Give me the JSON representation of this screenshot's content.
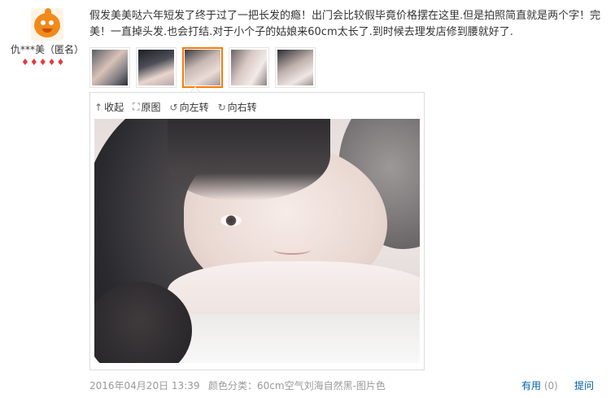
{
  "user": {
    "name": "仇***美（匿名）",
    "level_icons": [
      "gem-icon",
      "gem-icon",
      "gem-icon",
      "gem-icon",
      "gem-icon"
    ]
  },
  "review": {
    "text": "假发美美哒六年短发了终于过了一把长发的瘾！出门会比较假毕竟价格摆在这里.但是拍照简直就是两个字！完美！一直掉头发.也会打结.对于小个子的姑娘来60cm太长了.到时候去理发店修到腰就好了."
  },
  "thumbnails": {
    "count": 5,
    "active_index": 2
  },
  "viewer_toolbar": {
    "collapse": "收起",
    "original": "原图",
    "rotate_left": "向左转",
    "rotate_right": "向右转"
  },
  "footer": {
    "date": "2016年04月20日 13:39",
    "variant_label": "颜色分类：",
    "variant_value": "60cm空气刘海自然黑-图片色",
    "helpful_label": "有用",
    "helpful_count": "(0)",
    "reply_label": "提问"
  },
  "colors": {
    "active_thumb_border": "#ff7a00",
    "link": "#005ea7",
    "meta_text": "#999999",
    "level_gem": "#e4393c"
  }
}
